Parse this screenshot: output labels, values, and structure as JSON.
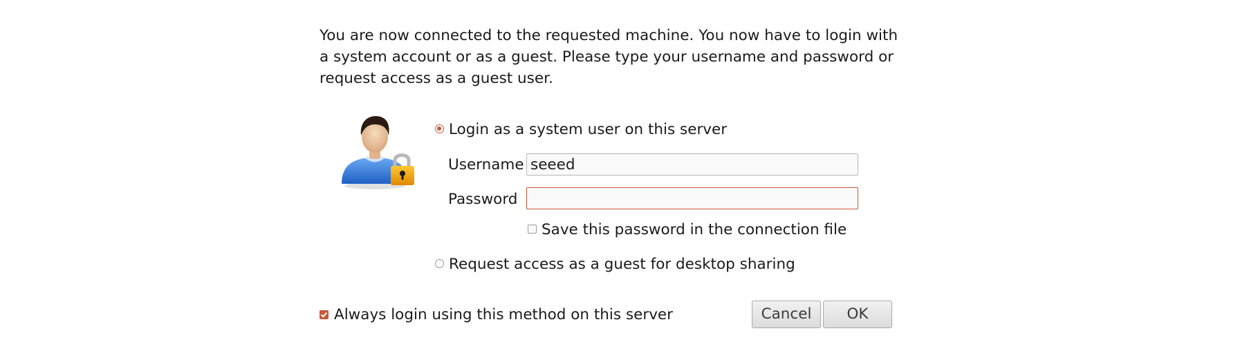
{
  "dialog": {
    "intro_text": "You are now connected to the requested machine. You now have to login with a system account or as a guest. Please type your username and password or request access as a guest user.",
    "options": {
      "system_user_label": "Login as a system user on this server",
      "system_user_selected": true,
      "guest_label": "Request access as a guest for desktop sharing",
      "guest_selected": false
    },
    "username": {
      "label": "Username",
      "value": "seeed"
    },
    "password": {
      "label": "Password",
      "value": ""
    },
    "save_password": {
      "label": "Save this password in the connection file",
      "checked": false
    },
    "always_login": {
      "label": "Always login using this method on this server",
      "checked": true
    },
    "buttons": {
      "cancel_label": "Cancel",
      "ok_label": "OK"
    },
    "colors": {
      "accent": "#c9573a",
      "avatar_shirt": "#2f7fe0",
      "lock": "#f0a30a"
    },
    "icons": {
      "avatar": "user-lock-icon"
    }
  }
}
